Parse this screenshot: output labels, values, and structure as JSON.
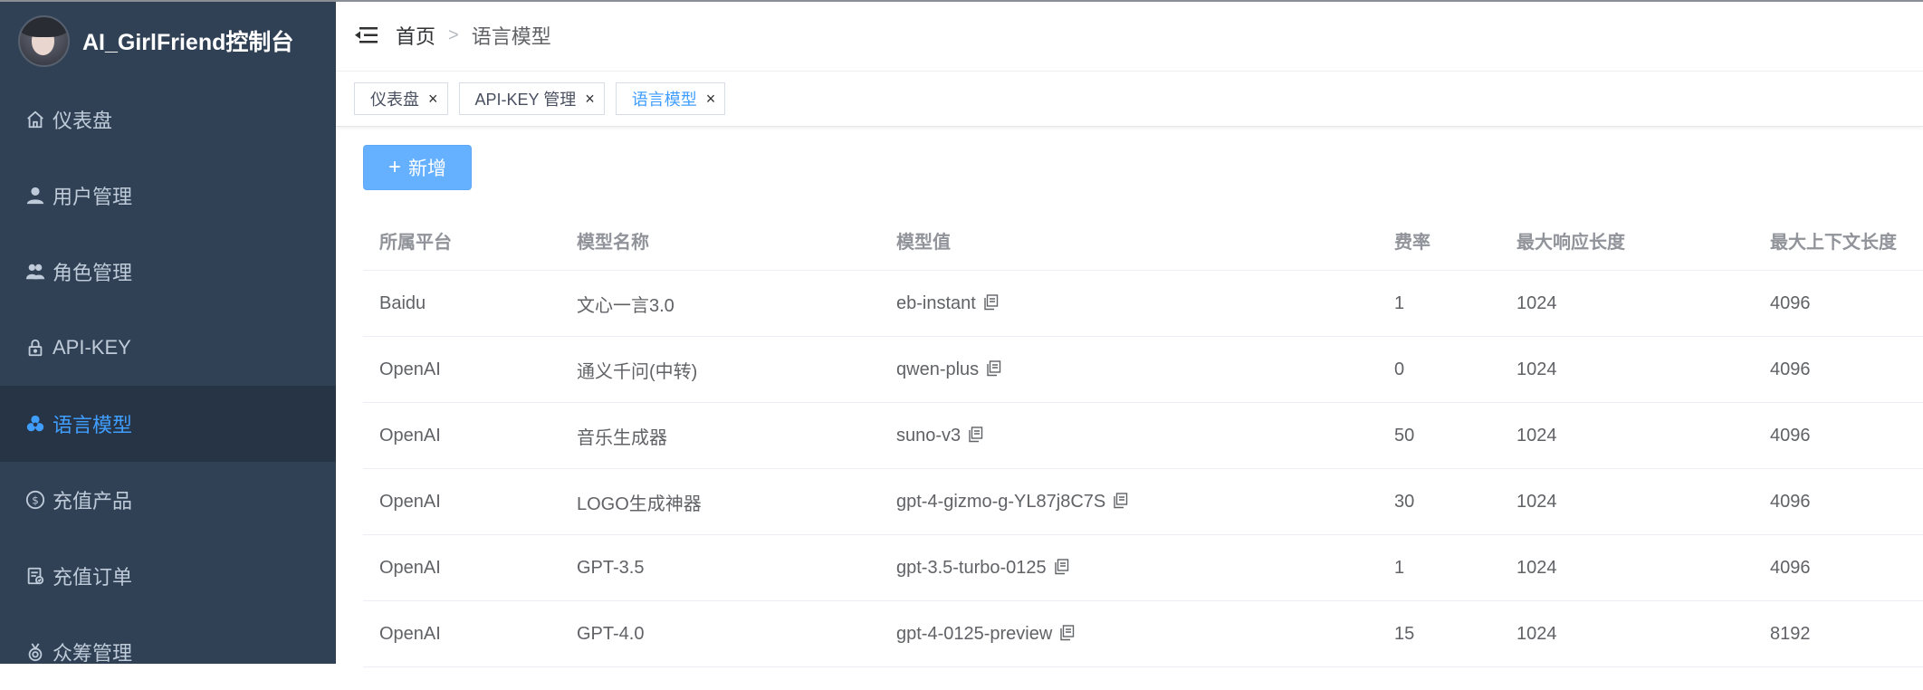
{
  "brand": {
    "title": "AI_GirlFriend控制台"
  },
  "sidebar": {
    "items": [
      {
        "label": "仪表盘",
        "icon": "home-icon"
      },
      {
        "label": "用户管理",
        "icon": "user-icon"
      },
      {
        "label": "角色管理",
        "icon": "people-icon"
      },
      {
        "label": "API-KEY",
        "icon": "lock-icon"
      },
      {
        "label": "语言模型",
        "icon": "model-icon",
        "active": true
      },
      {
        "label": "充值产品",
        "icon": "dollar-icon"
      },
      {
        "label": "充值订单",
        "icon": "order-icon"
      },
      {
        "label": "众筹管理",
        "icon": "medal-icon"
      }
    ]
  },
  "breadcrumb": {
    "home": "首页",
    "separator": ">",
    "current": "语言模型"
  },
  "tags": [
    {
      "label": "仪表盘",
      "close": "×"
    },
    {
      "label": "API-KEY 管理",
      "close": "×"
    },
    {
      "label": "语言模型",
      "close": "×",
      "active": true
    }
  ],
  "toolbar": {
    "add_label": "新增",
    "add_icon": "+"
  },
  "table": {
    "columns": [
      "所属平台",
      "模型名称",
      "模型值",
      "费率",
      "最大响应长度",
      "最大上下文长度"
    ],
    "rows": [
      [
        "Baidu",
        "文心一言3.0",
        "eb-instant",
        "1",
        "1024",
        "4096"
      ],
      [
        "OpenAI",
        "通义千问(中转)",
        "qwen-plus",
        "0",
        "1024",
        "4096"
      ],
      [
        "OpenAI",
        "音乐生成器",
        "suno-v3",
        "50",
        "1024",
        "4096"
      ],
      [
        "OpenAI",
        "LOGO生成神器",
        "gpt-4-gizmo-g-YL87j8C7S",
        "30",
        "1024",
        "4096"
      ],
      [
        "OpenAI",
        "GPT-3.5",
        "gpt-3.5-turbo-0125",
        "1",
        "1024",
        "4096"
      ],
      [
        "OpenAI",
        "GPT-4.0",
        "gpt-4-0125-preview",
        "15",
        "1024",
        "8192"
      ]
    ]
  },
  "colors": {
    "sidebar_bg": "#304156",
    "sidebar_active_bg": "#263445",
    "accent": "#409eff",
    "button_bg": "#66b1ff"
  }
}
